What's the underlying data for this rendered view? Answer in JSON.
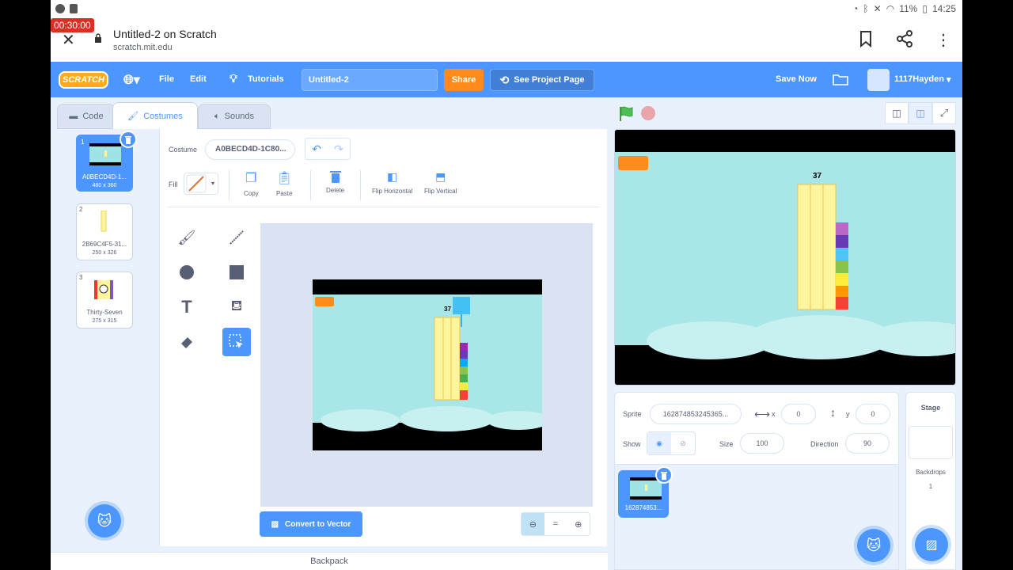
{
  "status": {
    "timer": "00:30:00",
    "battery": "11%",
    "time": "14:25"
  },
  "browser": {
    "title": "Untitled-2 on Scratch",
    "url": "scratch.mit.edu"
  },
  "menubar": {
    "logo": "SCRATCH",
    "file": "File",
    "edit": "Edit",
    "tutorials": "Tutorials",
    "project_title": "Untitled-2",
    "share": "Share",
    "see_project": "See Project Page",
    "save_now": "Save Now",
    "username": "1117Hayden"
  },
  "tabs": {
    "code": "Code",
    "costumes": "Costumes",
    "sounds": "Sounds"
  },
  "costumes": [
    {
      "num": "1",
      "name": "A0BECD4D-1...",
      "size": "480 x 360"
    },
    {
      "num": "2",
      "name": "2B69C4F5-31...",
      "size": "250 x 326"
    },
    {
      "num": "3",
      "name": "Thirty-Seven",
      "size": "275 x 315"
    }
  ],
  "editor": {
    "costume_label": "Costume",
    "costume_name": "A0BECD4D-1C80...",
    "fill_label": "Fill",
    "copy": "Copy",
    "paste": "Paste",
    "delete": "Delete",
    "flip_h": "Flip Horizontal",
    "flip_v": "Flip Vertical",
    "convert": "Convert to Vector",
    "zoom_reset": "=",
    "canvas_number": "37"
  },
  "backpack": "Backpack",
  "stage": {
    "number_label": "37"
  },
  "sprite_info": {
    "sprite_label": "Sprite",
    "sprite_name": "162874853245365...",
    "x_label": "x",
    "x": "0",
    "y_label": "y",
    "y": "0",
    "show_label": "Show",
    "size_label": "Size",
    "size": "100",
    "direction_label": "Direction",
    "direction": "90",
    "tile_name": "162874853..."
  },
  "stage_side": {
    "title": "Stage",
    "backdrops_label": "Backdrops",
    "backdrops_count": "1"
  },
  "colors": {
    "scratch_blue": "#4c97ff",
    "share_orange": "#ff8c1a",
    "block_yellow": "#fff59d"
  }
}
